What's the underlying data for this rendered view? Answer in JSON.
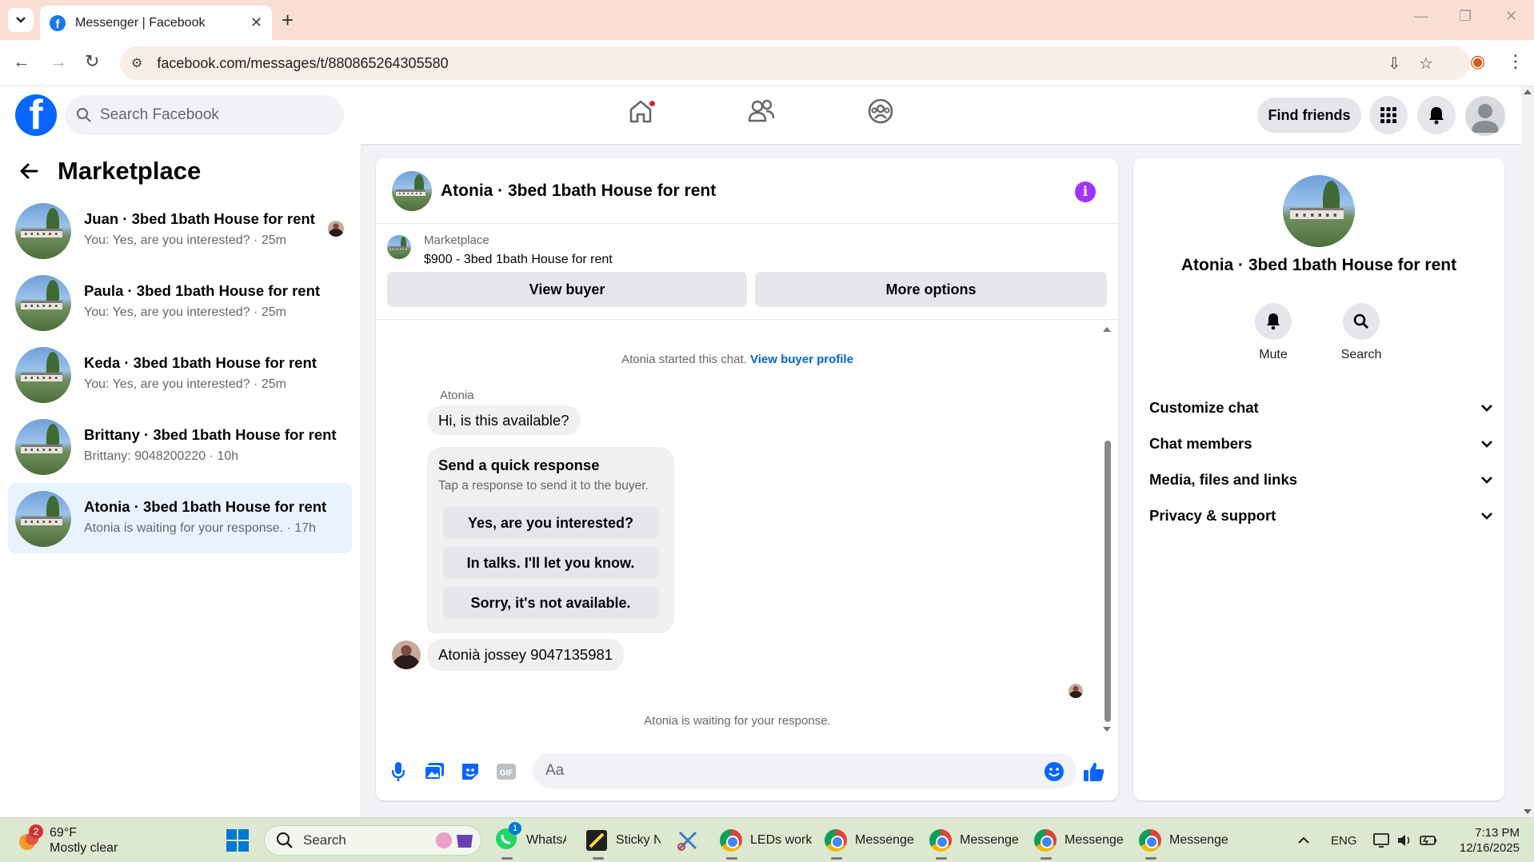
{
  "browser": {
    "tab_title": "Messenger | Facebook",
    "url": "facebook.com/messages/t/880865264305580"
  },
  "fb": {
    "search_placeholder": "Search Facebook",
    "find_friends": "Find friends"
  },
  "left": {
    "title": "Marketplace",
    "conversations": [
      {
        "name": "Juan · 3bed 1bath House for rent",
        "snippet": "You: Yes, are you interested? · 25m"
      },
      {
        "name": "Paula · 3bed 1bath House for rent",
        "snippet": "You: Yes, are you interested? · 25m"
      },
      {
        "name": "Keda · 3bed 1bath House for rent",
        "snippet": "You: Yes, are you interested? · 25m"
      },
      {
        "name": "Brittany · 3bed 1bath House for rent",
        "snippet": "Brittany: 9048200220 · 10h"
      },
      {
        "name": "Atonia · 3bed 1bath House for rent",
        "snippet": "Atonia is waiting for your response. · 17h"
      }
    ]
  },
  "chat": {
    "title": "Atonia · 3bed 1bath House for rent",
    "marketplace_label": "Marketplace",
    "listing": "$900 - 3bed 1bath House for rent",
    "view_buyer": "View buyer",
    "more_options": "More options",
    "started_text": "Atonia started this chat.",
    "view_buyer_profile": "View buyer profile",
    "sender": "Atonia",
    "message1": "Hi, is this available?",
    "quick_title": "Send a quick response",
    "quick_sub": "Tap a response to send it to the buyer.",
    "quick_options": [
      "Yes, are you interested?",
      "In talks. I'll let you know.",
      "Sorry, it's not available."
    ],
    "message2": "Atonià jossey 9047135981",
    "waiting": "Atonia is waiting for your response.",
    "composer_placeholder": "Aa"
  },
  "right": {
    "name": "Atonia · 3bed 1bath House for rent",
    "mute": "Mute",
    "search": "Search",
    "sections": [
      "Customize chat",
      "Chat members",
      "Media, files and links",
      "Privacy & support"
    ]
  },
  "taskbar": {
    "weather_temp": "69°F",
    "weather_desc": "Mostly clear",
    "weather_badge": "2",
    "search": "Search",
    "apps": [
      {
        "label": "WhatsA",
        "badge": "1"
      },
      {
        "label": "Sticky N"
      },
      {
        "label": "LEDs work"
      },
      {
        "label": "Messenge"
      },
      {
        "label": "Messenge"
      },
      {
        "label": "Messenge"
      },
      {
        "label": "Messenge"
      }
    ],
    "lang": "ENG",
    "time": "7:13 PM",
    "date": "12/16/2025"
  },
  "colors": {
    "fb_blue": "#0866ff",
    "link_blue": "#0064d1",
    "info_purple": "#a033ff",
    "active_row": "#e9f2ff"
  }
}
